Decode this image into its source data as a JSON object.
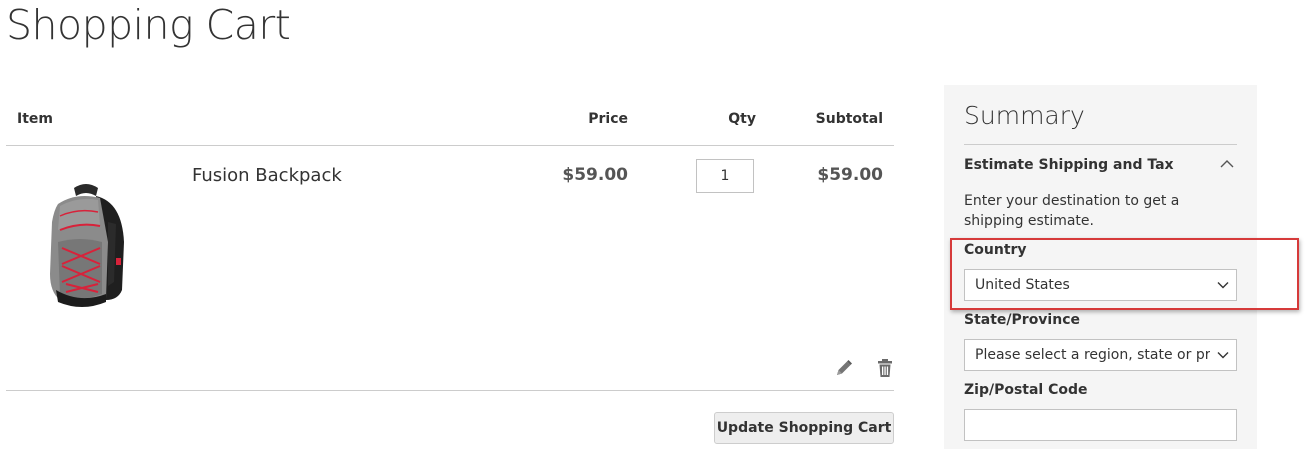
{
  "page": {
    "title": "Shopping Cart"
  },
  "cart": {
    "columns": {
      "item": "Item",
      "price": "Price",
      "qty": "Qty",
      "subtotal": "Subtotal"
    },
    "items": [
      {
        "name": "Fusion Backpack",
        "price": "$59.00",
        "qty": "1",
        "subtotal": "$59.00",
        "image": "backpack-image"
      }
    ],
    "update_button": "Update Shopping Cart"
  },
  "summary": {
    "title": "Summary",
    "estimate_title": "Estimate Shipping and Tax",
    "estimate_desc": "Enter your destination to get a shipping estimate.",
    "country_label": "Country",
    "country_value": "United States",
    "state_label": "State/Province",
    "state_value": "Please select a region, state or province.",
    "zip_label": "Zip/Postal Code",
    "zip_value": ""
  },
  "colors": {
    "highlight": "#d63a3a",
    "summary_bg": "#f5f5f5",
    "button_bg": "#eeeeee"
  }
}
